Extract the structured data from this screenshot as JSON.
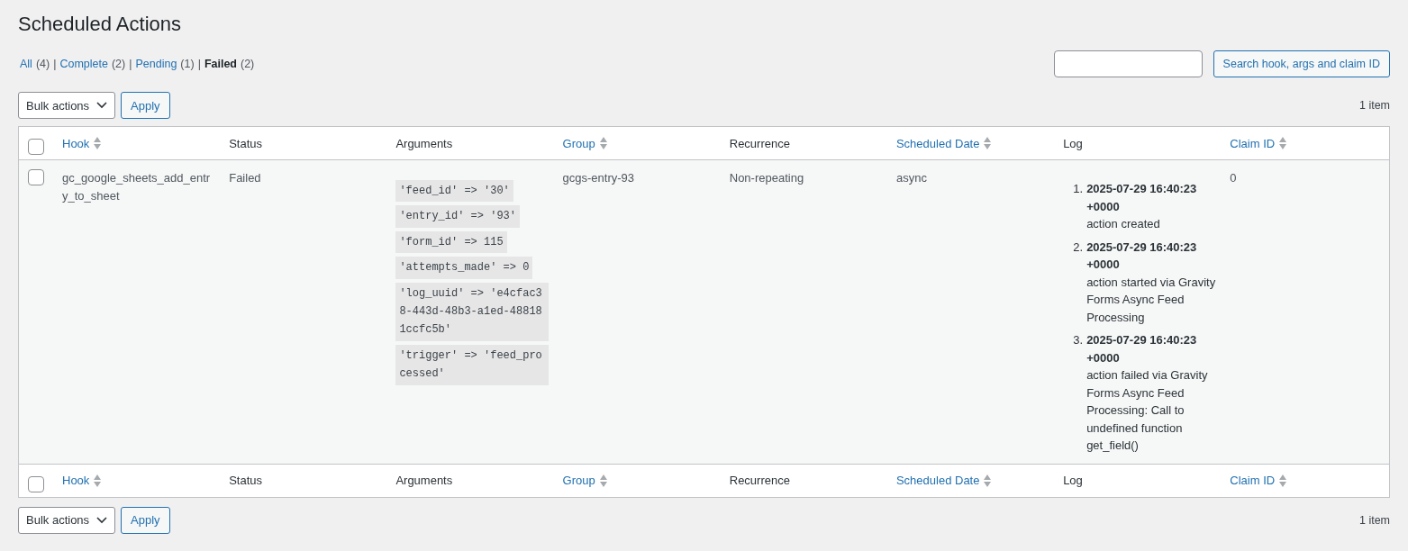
{
  "page_title": "Scheduled Actions",
  "views": [
    {
      "label": "All",
      "count": "(4)",
      "selected": false,
      "separator": "|"
    },
    {
      "label": "Complete",
      "count": "(2)",
      "selected": false,
      "separator": "|"
    },
    {
      "label": "Pending",
      "count": "(1)",
      "selected": false,
      "separator": "|"
    },
    {
      "label": "Failed",
      "count": "(2)",
      "selected": true
    }
  ],
  "search": {
    "button": "Search hook, args and claim ID"
  },
  "top_nav": {
    "bulk_actions": "Bulk actions",
    "apply": "Apply",
    "count": "1 item"
  },
  "table": {
    "header": {
      "checked": false,
      "columns": [
        {
          "label": "Hook",
          "sortable": true
        },
        {
          "label": "Status",
          "sortable": false
        },
        {
          "label": "Arguments",
          "sortable": false
        },
        {
          "label": "Group",
          "sortable": true
        },
        {
          "label": "Recurrence",
          "sortable": false
        },
        {
          "label": "Scheduled Date",
          "sortable": true
        },
        {
          "label": "Log",
          "sortable": false
        },
        {
          "label": "Claim ID",
          "sortable": true
        }
      ]
    },
    "rows": [
      {
        "checked": false,
        "hook": "gc_google_sheets_add_entry_to_sheet",
        "status": "Failed",
        "arguments": [
          "'feed_id' => '30'",
          "'entry_id' => '93'",
          "'form_id' => 115",
          "'attempts_made' => 0",
          "'log_uuid' => 'e4cfac38-443d-48b3-a1ed-488181ccfc5b'",
          "'trigger' => 'feed_processed'"
        ],
        "group": "gcgs-entry-93",
        "recurrence": "Non-repeating",
        "scheduled_date": "async",
        "log": [
          {
            "number": "1.",
            "date": "2025-07-29 16:40:23 +0000",
            "message": "action created"
          },
          {
            "number": "2.",
            "date": "2025-07-29 16:40:23 +0000",
            "message": "action started via Gravity Forms Async Feed Processing"
          },
          {
            "number": "3.",
            "date": "2025-07-29 16:40:23 +0000",
            "message": "action failed via Gravity Forms Async Feed Processing: Call to undefined function get_field()"
          }
        ],
        "claim_id": "0"
      }
    ],
    "footer": {
      "checked": false,
      "columns": [
        {
          "label": "Hook",
          "sortable": true
        },
        {
          "label": "Status",
          "sortable": false
        },
        {
          "label": "Arguments",
          "sortable": false
        },
        {
          "label": "Group",
          "sortable": true
        },
        {
          "label": "Recurrence",
          "sortable": false
        },
        {
          "label": "Scheduled Date",
          "sortable": true
        },
        {
          "label": "Log",
          "sortable": false
        },
        {
          "label": "Claim ID",
          "sortable": true
        }
      ]
    }
  },
  "bottom_nav": {
    "bulk_actions": "Bulk actions",
    "apply": "Apply",
    "count": "1 item"
  }
}
